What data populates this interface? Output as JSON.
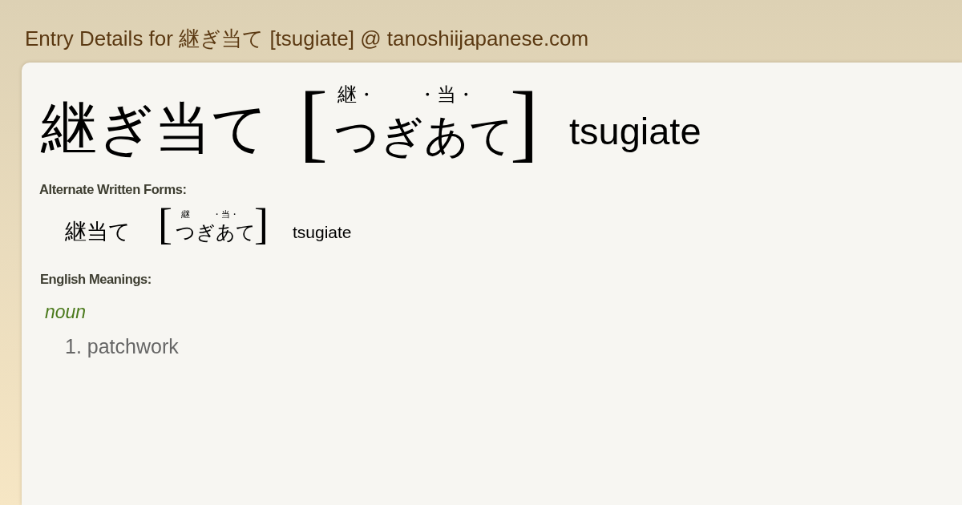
{
  "header": {
    "title": "Entry Details for 継ぎ当て [tsugiate] @ tanoshiijapanese.com"
  },
  "entry": {
    "written_form": "継ぎ当て",
    "reading": {
      "open_bracket": "[",
      "segments": [
        {
          "kana": "つ",
          "ruby": "継・"
        },
        {
          "kana": "ぎ"
        },
        {
          "kana": "あ",
          "ruby": "・当・"
        },
        {
          "kana": "て"
        }
      ],
      "close_bracket": "]"
    },
    "romaji": "tsugiate"
  },
  "alternate_forms": {
    "heading": "Alternate Written Forms:",
    "forms": [
      {
        "written_form": "継当て",
        "reading": {
          "open_bracket": "[",
          "segments": [
            {
              "kana": "つ",
              "ruby": "継"
            },
            {
              "kana": "ぎ"
            },
            {
              "kana": "あ",
              "ruby": "・当・"
            },
            {
              "kana": "て"
            }
          ],
          "close_bracket": "]"
        },
        "romaji": "tsugiate"
      }
    ]
  },
  "meanings": {
    "heading": "English Meanings:",
    "groups": [
      {
        "part_of_speech": "noun",
        "senses": [
          "1. patchwork"
        ]
      }
    ]
  }
}
